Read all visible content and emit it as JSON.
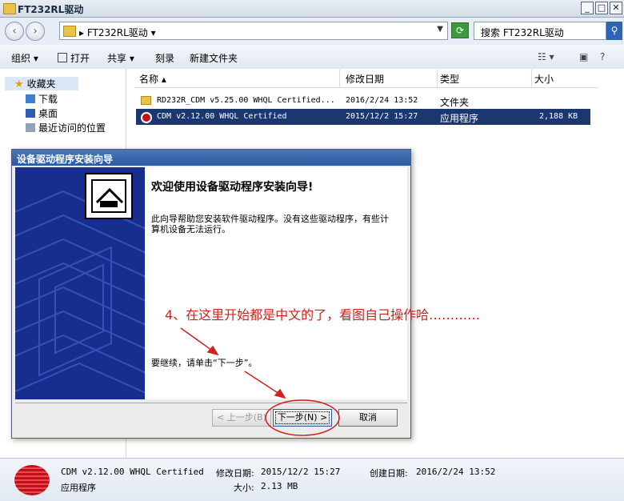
{
  "window": {
    "title": "FT232RL驱动"
  },
  "address": {
    "path": "FT232RL驱动"
  },
  "search": {
    "placeholder": "搜索 FT232RL驱动"
  },
  "toolbar": {
    "organize": "组织",
    "open": "打开",
    "share": "共享",
    "burn": "刻录",
    "new_folder": "新建文件夹"
  },
  "nav": {
    "favorites": "收藏夹",
    "items": [
      "下载",
      "桌面",
      "最近访问的位置"
    ]
  },
  "columns": [
    "名称",
    "修改日期",
    "类型",
    "大小"
  ],
  "files": [
    {
      "name": "RD232R_CDM v5.25.00 WHQL Certified...",
      "date": "2016/2/24 13:52",
      "type": "文件夹",
      "size": ""
    },
    {
      "name": "CDM v2.12.00 WHQL Certified",
      "date": "2015/12/2 15:27",
      "type": "应用程序",
      "size": "2,188 KB"
    }
  ],
  "status": {
    "name": "CDM v2.12.00 WHQL Certified",
    "kind": "应用程序",
    "modified_label": "修改日期:",
    "modified": "2015/12/2 15:27",
    "created_label": "创建日期:",
    "created": "2016/2/24 13:52",
    "size_label": "大小:",
    "size": "2.13 MB"
  },
  "dialog": {
    "title": "设备驱动程序安装向导",
    "heading": "欢迎使用设备驱动程序安装向导!",
    "body": "此向导帮助您安装软件驱动程序。没有这些驱动程序，有些计算机设备无法运行。",
    "continue_text": "要继续，请单击“下一步”。",
    "back": "< 上一步(B)",
    "next": "下一步(N) >",
    "cancel": "取消"
  },
  "annotation": "4、在这里开始都是中文的了，看图自己操作哈…………",
  "colors": {
    "selection": "#1c3770",
    "banner": "#172e8f",
    "annotation": "#d0221c"
  }
}
